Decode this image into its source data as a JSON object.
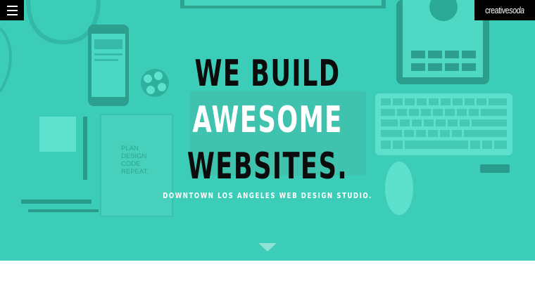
{
  "header": {
    "menu_icon": "hamburger-menu-icon",
    "logo": {
      "part1": "creative",
      "part2": "soda"
    }
  },
  "hero": {
    "headline_line1": "WE BUILD",
    "headline_line2": "AWESOME",
    "headline_line3": "WEBSITES.",
    "tagline": "DOWNTOWN LOS ANGELES WEB DESIGN STUDIO.",
    "notebook_text": [
      "PLAN",
      "DESIGN",
      "CODE",
      "REPEAT."
    ],
    "scroll_icon": "down-arrow-icon"
  },
  "colors": {
    "hero_teal": "#3ccdb8",
    "headline_dark": "#0c0c0c",
    "headline_light": "#ffffff",
    "bar_black": "#000000"
  }
}
